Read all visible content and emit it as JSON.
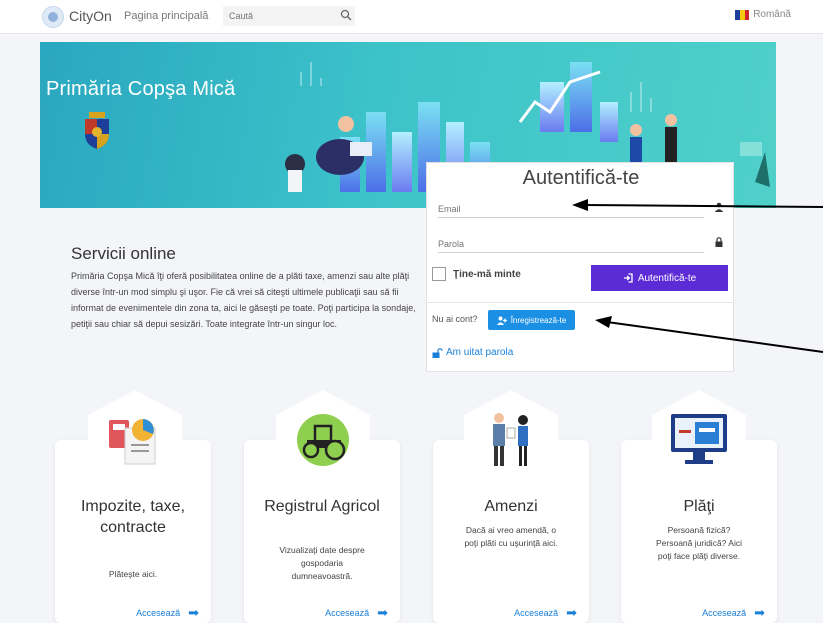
{
  "topbar": {
    "brand": "CityOn",
    "home_link": "Pagina principală",
    "search_placeholder": "Caută",
    "language": "Română"
  },
  "banner": {
    "title": "Primăria Copşa Mică"
  },
  "services": {
    "title": "Servicii online",
    "text": "Primăria Copşa Mică îţi oferă posibilitatea online de a plăti taxe, amenzi sau alte plăţi diverse într-un mod simplu şi uşor. Fie că vrei să citeşti ultimele publicaţii sau să fii informat de evenimentele din zona ta, aici le găseşti pe toate. Poţi participa la sondaje, petiţii sau chiar să depui sesizări. Toate integrate într-un singur loc."
  },
  "login": {
    "title": "Autentifică-te",
    "email_placeholder": "Email",
    "password_placeholder": "Parola",
    "remember_label": "Ţine-mă minte",
    "submit_label": "Autentifică-te",
    "no_account": "Nu ai cont?",
    "register_label": "Înregistrează-te",
    "forgot_label": "Am uitat parola"
  },
  "cards": [
    {
      "title": "Impozite, taxe, contracte",
      "desc": "Plăteşte aici.",
      "link": "Accesează",
      "icon": "calculator-icon"
    },
    {
      "title": "Registrul Agricol",
      "desc": "Vizualizaţi date despre gospodaria dumneavoastră.",
      "link": "Accesează",
      "icon": "tractor-icon"
    },
    {
      "title": "Amenzi",
      "desc": "Dacă ai vreo amendă, o poţi plăti cu uşurinţă aici.",
      "link": "Accesează",
      "icon": "officer-icon"
    },
    {
      "title": "Plăţi",
      "desc": "Persoană fizică? Persoană juridică? Aici poţi face plăţi diverse.",
      "link": "Accesează",
      "icon": "monitor-card-icon"
    }
  ],
  "colors": {
    "primary_button": "#5b2bd6",
    "register_button": "#1a8fe3",
    "link": "#1a7fd6",
    "banner": "#3cc2c9"
  }
}
